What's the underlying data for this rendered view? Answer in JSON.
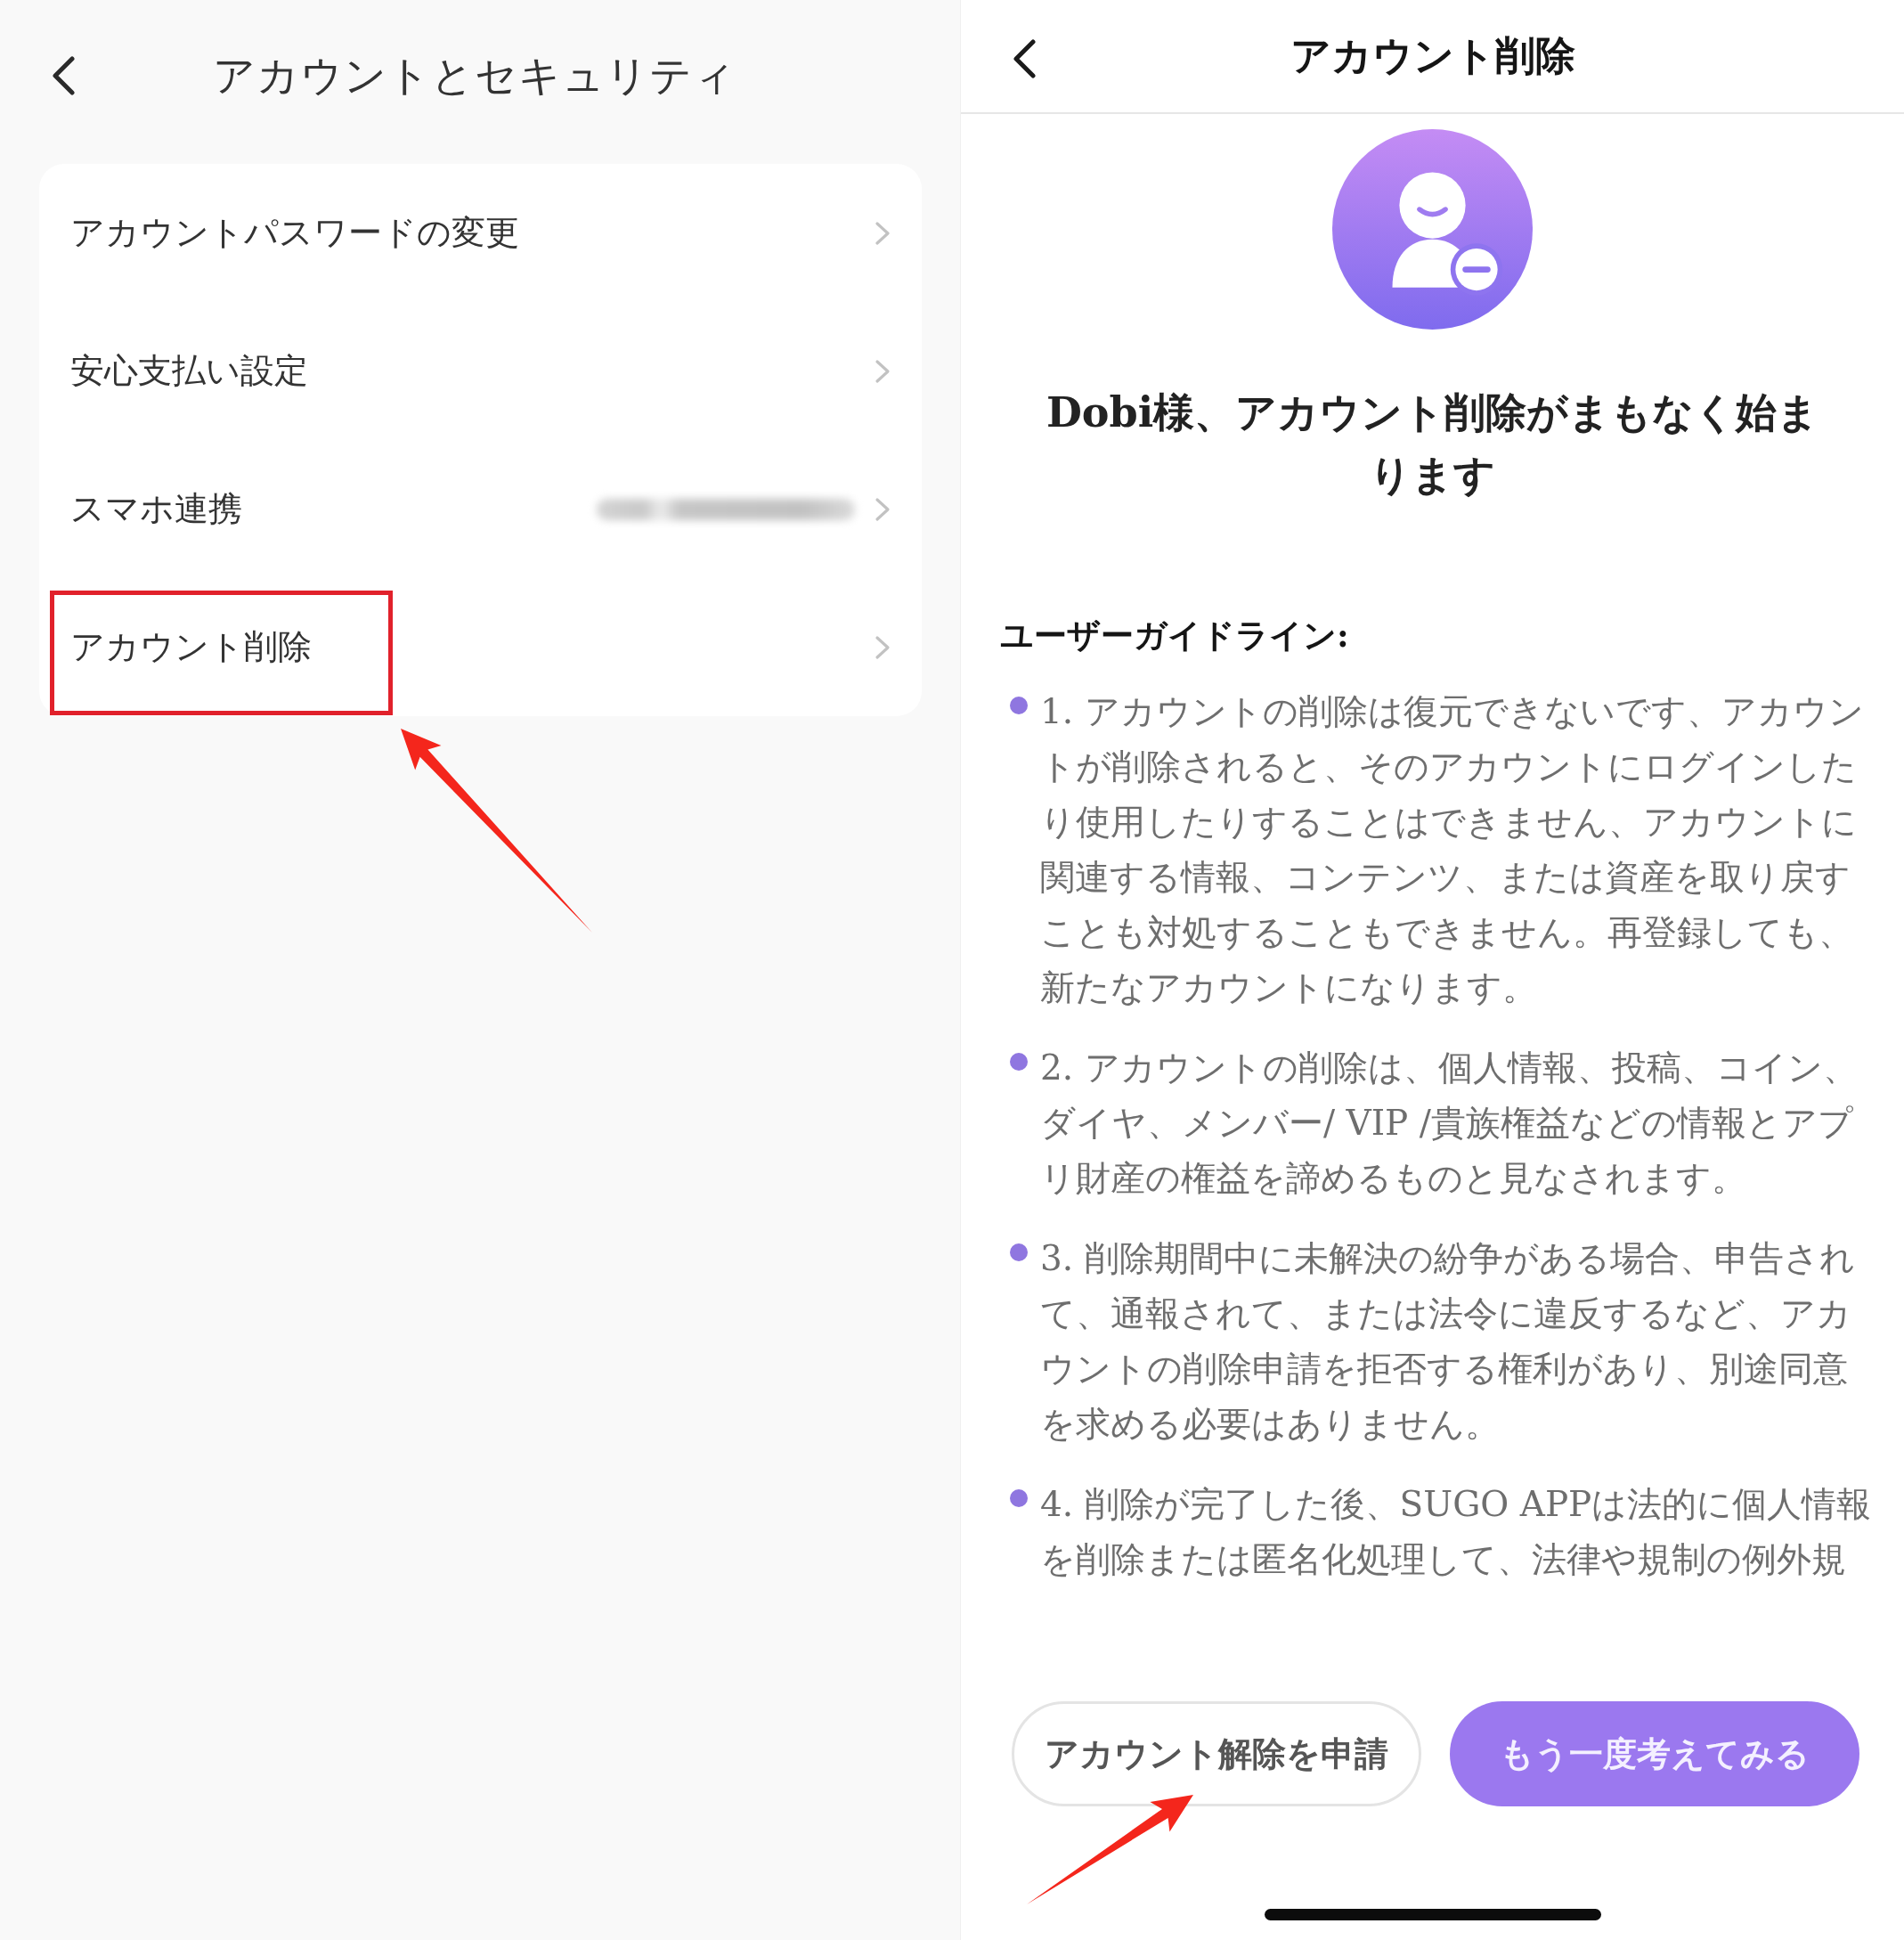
{
  "settings_screen": {
    "title": "アカウントとセキュリティ",
    "items": [
      {
        "label": "アカウントパスワードの変更",
        "value_blurred": false,
        "annotated": false
      },
      {
        "label": "安心支払い設定",
        "value_blurred": false,
        "annotated": false
      },
      {
        "label": "スマホ連携",
        "value_blurred": true,
        "annotated": false
      },
      {
        "label": "アカウント削除",
        "value_blurred": false,
        "annotated": true
      }
    ]
  },
  "deletion_screen": {
    "title": "アカウント削除",
    "heading": "Dobi様、アカウント削除がまもなく始まります",
    "guidelines_title": "ユーザーガイドライン:",
    "guidelines": [
      "1. アカウントの削除は復元できないです、アカウントが削除されると、そのアカウントにログインしたり使用したりすることはできません、アカウントに関連する情報、コンテンツ、または資産を取り戻すことも対処することもできません。再登録しても、新たなアカウントになります。",
      "2. アカウントの削除は、個人情報、投稿、コイン、ダイヤ、メンバー/ VIP /貴族権益などの情報とアプリ財産の権益を諦めるものと見なされます。",
      "3. 削除期間中に未解決の紛争がある場合、申告されて、通報されて、または法令に違反するなど、アカウントの削除申請を拒否する権利があり、別途同意を求める必要はありません。",
      "4. 削除が完了した後、SUGO APPは法的に個人情報を削除または匿名化処理して、法律や規制の例外規"
    ],
    "buttons": [
      {
        "label": "アカウント解除を申請",
        "kind": "secondary",
        "annotated": true
      },
      {
        "label": "もう一度考えてみる",
        "kind": "primary",
        "annotated": false
      }
    ]
  }
}
